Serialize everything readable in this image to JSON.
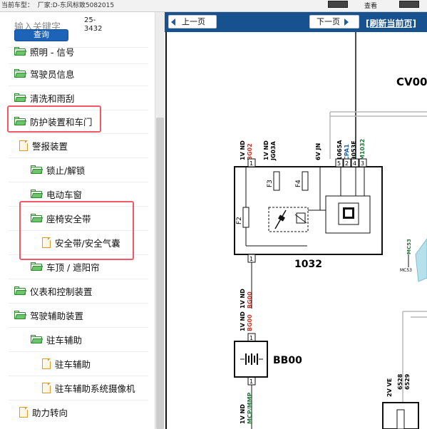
{
  "topbar": {
    "vehicle_label": "当前车型：",
    "vehicle_value": "厂家:D-东风标致5082015",
    "right_label": "查看"
  },
  "search": {
    "label": "输入关键字",
    "value": "25-\n3432",
    "button": "查询"
  },
  "tree": [
    {
      "label": "照明 - 信号",
      "type": "folder"
    },
    {
      "label": "驾驶员信息",
      "type": "folder"
    },
    {
      "label": "清洗和雨刮",
      "type": "folder"
    },
    {
      "label": "防护装置和车门",
      "type": "folder"
    },
    {
      "label": "警报装置",
      "type": "page"
    },
    {
      "label": "锁止/解锁",
      "type": "folder"
    },
    {
      "label": "电动车窗",
      "type": "folder"
    },
    {
      "label": "座椅安全带",
      "type": "folder"
    },
    {
      "label": "安全带/安全气囊",
      "type": "page"
    },
    {
      "label": "车顶 / 遮阳帘",
      "type": "folder"
    },
    {
      "label": "仪表和控制装置",
      "type": "folder"
    },
    {
      "label": "驾驶辅助装置",
      "type": "folder"
    },
    {
      "label": "驻车辅助",
      "type": "folder"
    },
    {
      "label": "驻车辅助",
      "type": "page"
    },
    {
      "label": "驻车辅助系统摄像机",
      "type": "page"
    },
    {
      "label": "助力转向",
      "type": "page"
    }
  ],
  "viewer": {
    "prev": "上一页",
    "next": "下一页",
    "refresh": "[刷新当前页]"
  },
  "diagram": {
    "title_code": "CV00",
    "labels": {
      "w1": "1V ND",
      "w2": "BG02",
      "w3": "1V ND",
      "w4": "JG03A",
      "w5": "6V JN",
      "w6": "1065A",
      "w7": "CPA1",
      "w8": "9053E",
      "w9": "M1032",
      "f2": "F2",
      "f3": "F3",
      "f4": "F4",
      "p1": "1",
      "p2": "2",
      "p3": "3",
      "p4": "4",
      "p5": "5",
      "p6": "1",
      "p7": "1",
      "unit1032": "1032",
      "w10": "1V ND",
      "w11": "BG00",
      "w12": "1V ND",
      "w13": "BG00",
      "pa": "1",
      "pb": "1",
      "bb00": "BB00",
      "w14": "1V ND",
      "w15": "MCP/MMP",
      "mc53": "MC53",
      "mc53b": "MC53",
      "w16": "2V VE",
      "w17": "6528",
      "w18": "6529"
    }
  },
  "colors": {
    "navbar": "#17518f",
    "highlight": "#f05866",
    "folder_green": "#6cc46c",
    "search_button": "#1d63b7",
    "wire_red": "#c0392b",
    "wire_green": "#1f7a3a",
    "wire_blue": "#1d5fa7"
  }
}
